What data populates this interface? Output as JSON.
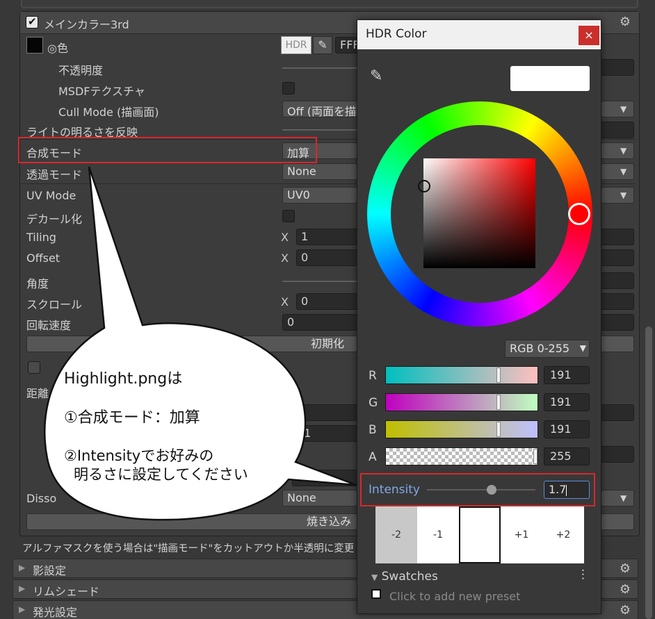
{
  "section": {
    "title": "メインカラー3rd",
    "color_label": "◎色",
    "hdr_badge": "HDR",
    "hex_partial": "FFF",
    "rows": {
      "opacity": "不透明度",
      "msdf": "MSDFテクスチャ",
      "cull": "Cull Mode (描画面)",
      "cull_value": "Off (両面を描",
      "light": "ライトの明るさを反映",
      "blend": "合成モード",
      "blend_value": "加算",
      "transparent": "透過モード",
      "transparent_value": "None",
      "uvmode": "UV Mode",
      "uvmode_value": "UV0",
      "decal": "デカール化",
      "tiling": "Tiling",
      "tiling_x": "1",
      "offset": "Offset",
      "offset_x": "0",
      "angle": "角度",
      "scroll": "スクロール",
      "scroll_x": "0",
      "rotspeed": "回転速度",
      "rotspeed_value": "0",
      "reset_button": "初期化",
      "distance": "距離",
      "field_a": "1",
      "field_b": "01",
      "dissolve": "Disso",
      "dissolve_value": "None",
      "bake_button": "焼き込み",
      "x": "X"
    },
    "alpha_note": "アルファマスクを使う場合は\"描画モード\"をカットアウトか半透明に変更"
  },
  "folds": [
    {
      "label": "影設定"
    },
    {
      "label": "リムシェード"
    },
    {
      "label": "発光設定"
    }
  ],
  "hdr_window": {
    "title": "HDR Color",
    "close": "×",
    "mode": "RGB 0-255",
    "channels": [
      {
        "name": "R",
        "value": "191",
        "level": 0.75
      },
      {
        "name": "G",
        "value": "191",
        "level": 0.75
      },
      {
        "name": "B",
        "value": "191",
        "level": 0.75
      },
      {
        "name": "A",
        "value": "255",
        "level": 1.0
      }
    ],
    "intensity_label": "Intensity",
    "intensity_value": "1.7",
    "stops": [
      "-2",
      "-1",
      "",
      "+1",
      "+2"
    ],
    "swatches_title": "Swatches",
    "swatches_add": "Click to add new preset",
    "colors": {
      "preview": "#ffffff",
      "highlight": "#d9282b",
      "accent": "#7ea9e8"
    }
  },
  "bubble": {
    "line1": "Highlight.pngは",
    "line2": "①合成モード：加算",
    "line3": "②Intensityでお好みの",
    "line4": "明るさに設定してください"
  }
}
